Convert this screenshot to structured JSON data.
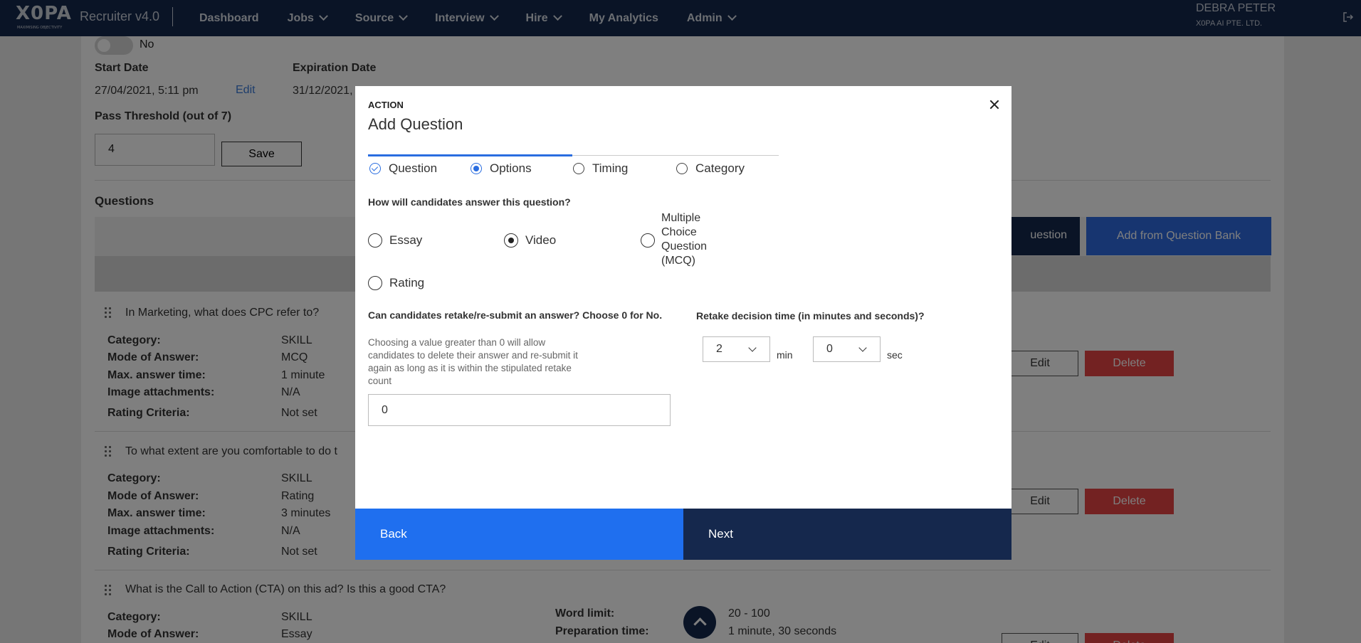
{
  "nav": {
    "logo": "X0PA",
    "logo_tag": "MAXIMISING OBJECTIVITY",
    "app_name": "Recruiter v4.0",
    "items": [
      "Dashboard",
      "Jobs",
      "Source",
      "Interview",
      "Hire",
      "My Analytics",
      "Admin"
    ],
    "user_name": "DEBRA PETER",
    "company": "X0PA AI PTE. LTD."
  },
  "page": {
    "toggle_label": "No",
    "start_date_label": "Start Date",
    "start_date": "27/04/2021, 5:11 pm",
    "edit_link": "Edit",
    "expiration_label": "Expiration Date",
    "expiration_date": "31/12/2021,",
    "threshold_label": "Pass Threshold (out of 7)",
    "threshold_value": "4",
    "save": "Save",
    "questions_heading": "Questions",
    "add_question": "uestion",
    "add_bank": "Add from Question Bank",
    "labels": {
      "category": "Category:",
      "mode": "Mode of Answer:",
      "max_time": "Max. answer time:",
      "images": "Image attachments:",
      "rating": "Rating Criteria:",
      "word_limit": "Word limit:",
      "prep_time": "Preparation time:"
    },
    "edit": "Edit",
    "delete": "Delete",
    "questions": [
      {
        "title": "In Marketing, what does CPC refer to?",
        "category": "SKILL",
        "mode": "MCQ",
        "max_time": "1 minute",
        "images": "N/A",
        "rating": "Not set"
      },
      {
        "title": "To what extent are you comfortable to do t",
        "category": "SKILL",
        "mode": "Rating",
        "max_time": "3 minutes",
        "images": "N/A",
        "rating": "Not set"
      },
      {
        "title": "What is the Call to Action (CTA) on this ad? Is this a good CTA?",
        "category": "SKILL",
        "mode": "Essay",
        "word_limit": "20 - 100",
        "prep_time": "1 minute, 30 seconds"
      }
    ]
  },
  "modal": {
    "kicker": "ACTION",
    "title": "Add Question",
    "steps": [
      "Question",
      "Options",
      "Timing",
      "Category"
    ],
    "answer_question": "How will candidates answer this question?",
    "answer_options": {
      "essay": "Essay",
      "video": "Video",
      "mcq": "Multiple Choice Question (MCQ)",
      "rating": "Rating"
    },
    "selected_option": "Video",
    "retake_label": "Can candidates retake/re-submit an answer? Choose 0 for No.",
    "retake_help": "Choosing a value greater than 0 will allow candidates to delete their answer and re-submit it again as long as it is within the stipulated retake count",
    "retake_value": "0",
    "decision_label": "Retake decision time (in minutes and seconds)?",
    "minutes_value": "2",
    "min_unit": "min",
    "seconds_value": "0",
    "sec_unit": "sec",
    "back": "Back",
    "next": "Next"
  }
}
